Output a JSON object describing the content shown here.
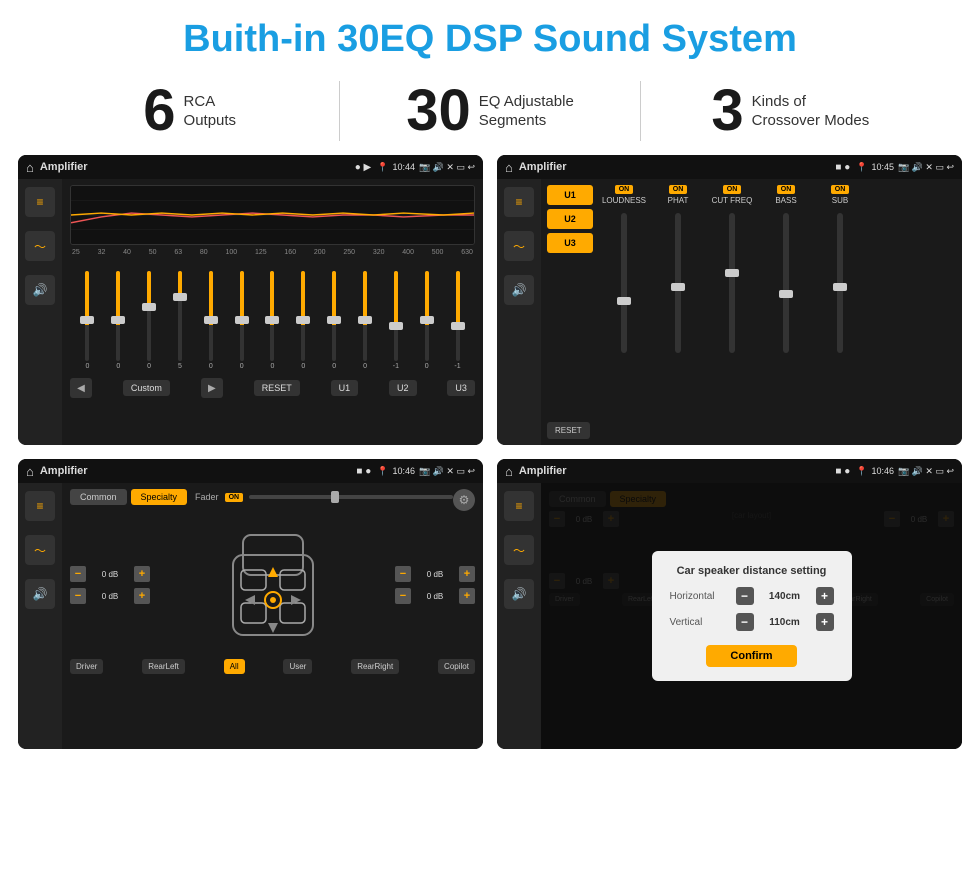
{
  "page": {
    "title": "Buith-in 30EQ DSP Sound System"
  },
  "stats": [
    {
      "number": "6",
      "text_line1": "RCA",
      "text_line2": "Outputs"
    },
    {
      "number": "30",
      "text_line1": "EQ Adjustable",
      "text_line2": "Segments"
    },
    {
      "number": "3",
      "text_line1": "Kinds of",
      "text_line2": "Crossover Modes"
    }
  ],
  "screens": [
    {
      "id": "screen1",
      "status_bar": {
        "app_name": "Amplifier",
        "time": "10:44"
      },
      "eq_labels": [
        "25",
        "32",
        "40",
        "50",
        "63",
        "80",
        "100",
        "125",
        "160",
        "200",
        "250",
        "320",
        "400",
        "500",
        "630"
      ],
      "eq_values": [
        "0",
        "0",
        "0",
        "5",
        "0",
        "0",
        "0",
        "0",
        "0",
        "0",
        "-1",
        "0",
        "-1"
      ],
      "bottom_buttons": [
        "Custom",
        "RESET",
        "U1",
        "U2",
        "U3"
      ]
    },
    {
      "id": "screen2",
      "status_bar": {
        "app_name": "Amplifier",
        "time": "10:45"
      },
      "presets": [
        "U1",
        "U2",
        "U3"
      ],
      "channels": [
        "LOUDNESS",
        "PHAT",
        "CUT FREQ",
        "BASS",
        "SUB"
      ],
      "reset_label": "RESET"
    },
    {
      "id": "screen3",
      "status_bar": {
        "app_name": "Amplifier",
        "time": "10:46"
      },
      "mode_tabs": [
        "Common",
        "Specialty"
      ],
      "fader_label": "Fader",
      "volumes": [
        {
          "label": "0 dB"
        },
        {
          "label": "0 dB"
        },
        {
          "label": "0 dB"
        },
        {
          "label": "0 dB"
        }
      ],
      "bottom_buttons": [
        "Driver",
        "RearLeft",
        "All",
        "User",
        "RearRight",
        "Copilot"
      ]
    },
    {
      "id": "screen4",
      "status_bar": {
        "app_name": "Amplifier",
        "time": "10:46"
      },
      "dialog": {
        "title": "Car speaker distance setting",
        "horizontal_label": "Horizontal",
        "horizontal_value": "140cm",
        "vertical_label": "Vertical",
        "vertical_value": "110cm",
        "confirm_label": "Confirm"
      }
    }
  ]
}
